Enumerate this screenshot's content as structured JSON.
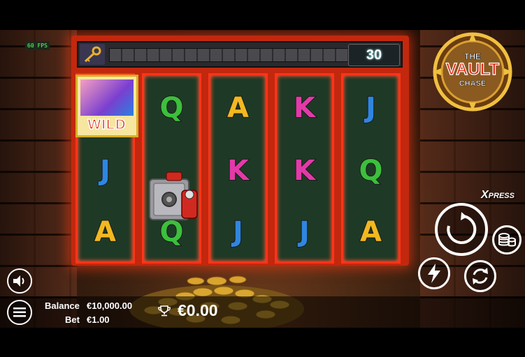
{
  "fps_label": "60 FPS",
  "spins_counter": "30",
  "logo": {
    "line1": "THE",
    "line2": "VAULT",
    "line3": "CHASE"
  },
  "wild_label": "WILD",
  "reels": [
    [
      "WILD",
      "J",
      "A"
    ],
    [
      "Q",
      "SAFE",
      "Q"
    ],
    [
      "A",
      "K",
      "J"
    ],
    [
      "K",
      "K",
      "J"
    ],
    [
      "J",
      "Q",
      "A"
    ]
  ],
  "xpress": {
    "x": "X",
    "rest": "PRESS"
  },
  "balance": {
    "label": "Balance",
    "value": "€10,000.00"
  },
  "bet": {
    "label": "Bet",
    "value": "€1.00"
  },
  "win_value": "€0.00",
  "colors": {
    "frame": "#c2280e",
    "reel_bg": "#1e3a26",
    "Q": "#3cbf3c",
    "A": "#f2b820",
    "K": "#e23aa8",
    "J": "#2f86e0"
  },
  "icons": [
    "key-icon",
    "sound-icon",
    "menu-icon",
    "trophy-icon",
    "spin-icon",
    "coin-stack-icon",
    "lightning-icon",
    "autoplay-icon"
  ]
}
